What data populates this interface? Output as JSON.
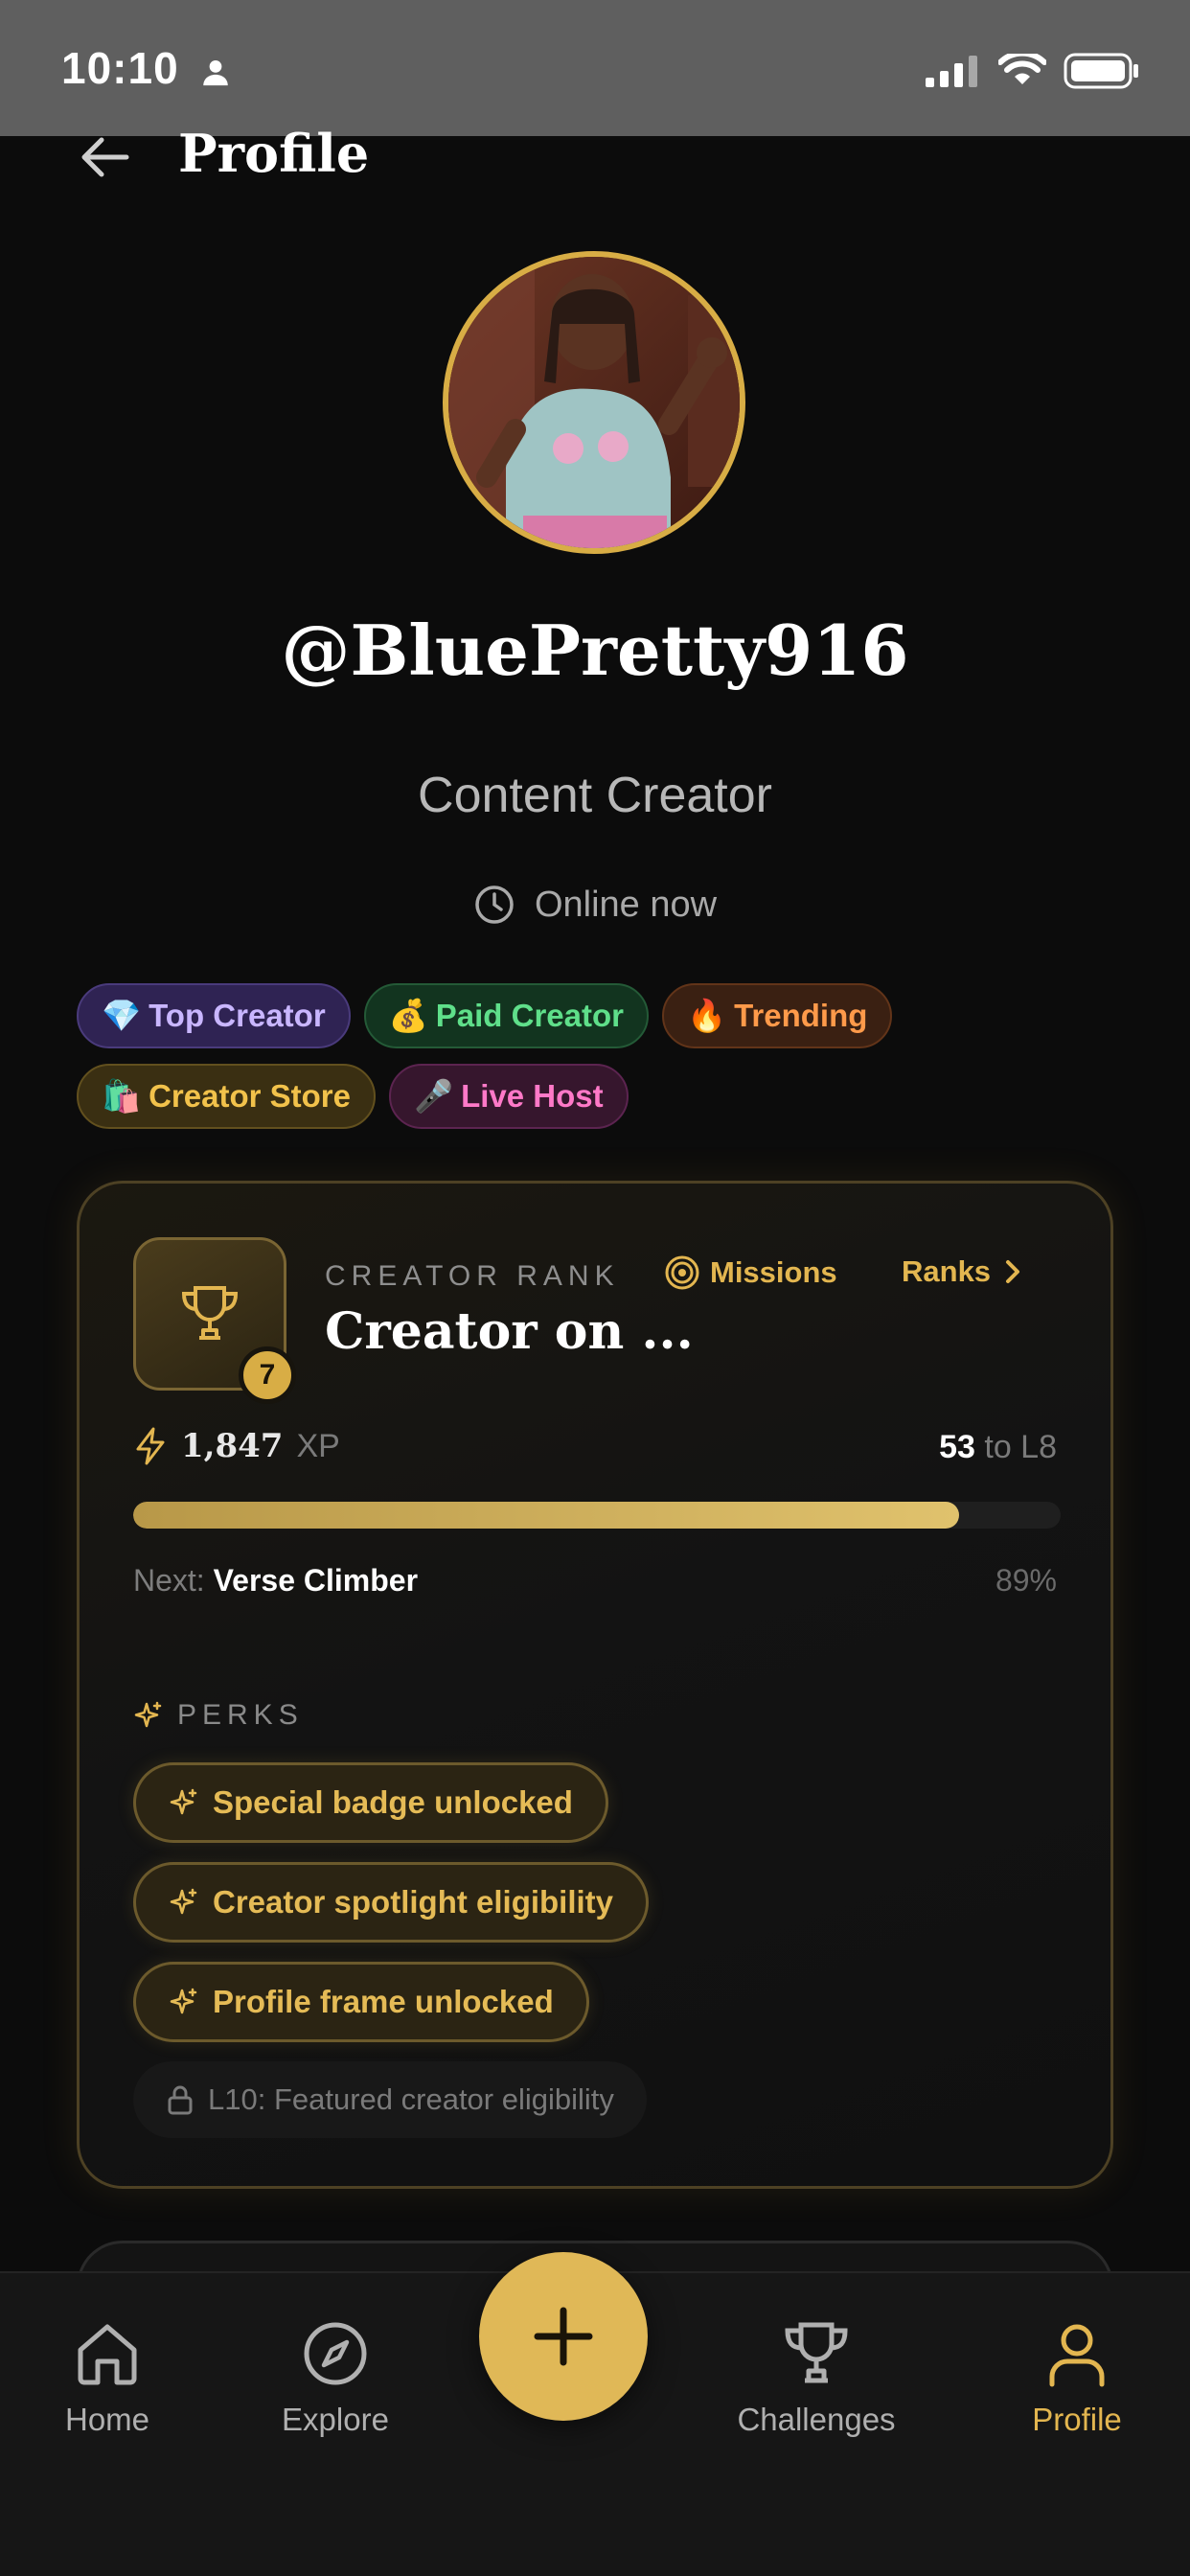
{
  "status_bar": {
    "time": "10:10"
  },
  "header": {
    "title": "Profile"
  },
  "profile": {
    "username": "@BluePretty916",
    "role": "Content Creator",
    "presence": "Online now"
  },
  "badges": [
    {
      "emoji": "💎",
      "label": "Top Creator",
      "color": "#c9b6ff"
    },
    {
      "emoji": "💰",
      "label": "Paid Creator",
      "color": "#5fdf8a"
    },
    {
      "emoji": "🔥",
      "label": "Trending",
      "color": "#ff9a4a"
    },
    {
      "emoji": "🛍️",
      "label": "Creator Store",
      "color": "#f2c24b"
    },
    {
      "emoji": "🎤",
      "label": "Live Host",
      "color": "#ff79c8"
    }
  ],
  "rank_card": {
    "label": "CREATOR RANK",
    "name": "Creator on ...",
    "level": "7",
    "missions_label": "Missions",
    "ranks_label": "Ranks",
    "xp_value": "1,847",
    "xp_unit": "XP",
    "to_next_value": "53",
    "to_next_suffix": "to L8",
    "progress_fraction": 0.89,
    "next_prefix": "Next:",
    "next_name": "Verse Climber",
    "percent_text": "89%",
    "perks_label": "PERKS",
    "perks": [
      "Special badge unlocked",
      "Creator spotlight eligibility",
      "Profile frame unlocked"
    ],
    "locked_perk": "L10: Featured creator eligibility"
  },
  "nav": {
    "home": "Home",
    "explore": "Explore",
    "challenges": "Challenges",
    "profile": "Profile"
  },
  "colors": {
    "accent": "#e0b857",
    "background": "#0c0c0c"
  }
}
